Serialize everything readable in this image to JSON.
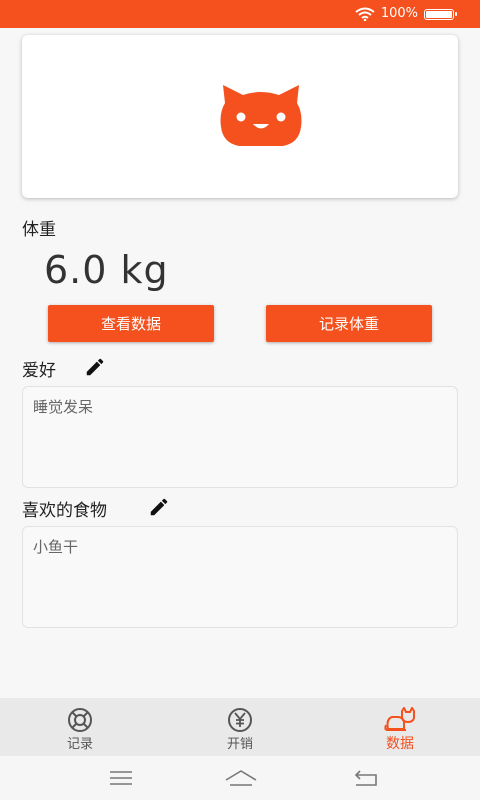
{
  "status_bar": {
    "battery_text": "100%",
    "battery_level": 1.0,
    "icons": [
      "wifi-icon",
      "battery-icon"
    ]
  },
  "header": {
    "logo_icon": "cat-face-icon"
  },
  "weight": {
    "label": "体重",
    "value": "6.0 kg"
  },
  "actions": {
    "view_data_label": "查看数据",
    "record_weight_label": "记录体重"
  },
  "hobby": {
    "label": "爱好",
    "value": "睡觉发呆",
    "edit_icon": "pencil-icon"
  },
  "favorite_food": {
    "label": "喜欢的食物",
    "value": "小鱼干",
    "edit_icon": "pencil-icon"
  },
  "tabs": [
    {
      "label": "记录",
      "icon": "lifebuoy-icon",
      "active": false
    },
    {
      "label": "开销",
      "icon": "yen-icon",
      "active": false
    },
    {
      "label": "数据",
      "icon": "cat-icon",
      "active": true
    }
  ],
  "nav": {
    "icons": [
      "menu-icon",
      "home-icon",
      "back-icon"
    ]
  },
  "colors": {
    "accent": "#f4511e",
    "background": "#f7f7f7",
    "tab_bar": "#e9e9e9"
  }
}
